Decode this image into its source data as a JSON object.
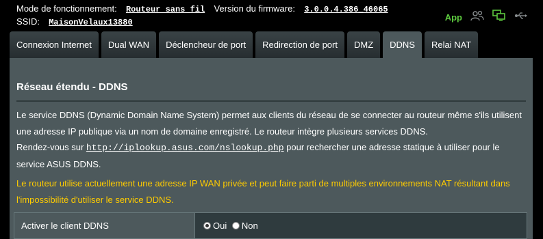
{
  "status": {
    "mode_label": "Mode de fonctionnement:",
    "mode_value": "Routeur sans fil",
    "firmware_label": "Version du firmware:",
    "firmware_value": "3.0.0.4.386_46065",
    "ssid_label": "SSID:",
    "ssid_value": "MaisonVelaux13880",
    "app_label": "App",
    "icons": [
      "users-icon",
      "network-monitor-icon",
      "usb-icon"
    ]
  },
  "tabs": [
    {
      "label": "Connexion Internet",
      "active": false
    },
    {
      "label": "Dual WAN",
      "active": false
    },
    {
      "label": "Déclencheur de port",
      "active": false
    },
    {
      "label": "Redirection de port",
      "active": false
    },
    {
      "label": "DMZ",
      "active": false
    },
    {
      "label": "DDNS",
      "active": true
    },
    {
      "label": "Relai NAT",
      "active": false
    }
  ],
  "main": {
    "title": "Réseau étendu - DDNS",
    "desc_line1": "Le service DDNS (Dynamic Domain Name System) permet aux clients du réseau de se connecter au routeur même s'ils utilisent",
    "desc_line2": "une adresse IP publique via un nom de domaine enregistré. Le routeur intègre plusieurs services DDNS.",
    "desc_line3_pre": "Rendez-vous sur ",
    "desc_link": "http://iplookup.asus.com/nslookup.php",
    "desc_line3_post": " pour rechercher une adresse statique à utiliser pour le",
    "desc_line4": "service ASUS DDNS.",
    "warn_line1": "Le routeur utilise actuellement une adresse IP WAN privée et peut faire parti de multiples environnements NAT résultant dans",
    "warn_line2": "l'impossibilité d'utiliser le service DDNS."
  },
  "form": {
    "enable_label": "Activer le client DDNS",
    "option_yes": "Oui",
    "option_no": "Non",
    "selected": "Oui"
  },
  "colors": {
    "panel": "#4d595c",
    "warning": "#ffcc00",
    "app_green": "#5cc93e"
  }
}
